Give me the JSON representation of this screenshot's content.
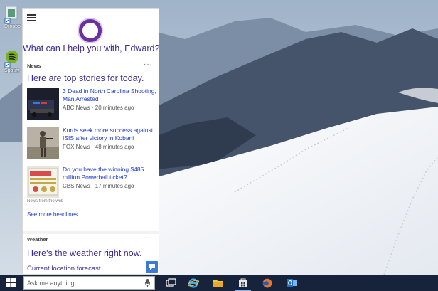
{
  "desktop": {
    "icons": [
      {
        "label": "Dropbox"
      },
      {
        "label": "Spotify"
      }
    ]
  },
  "cortana": {
    "greeting": "What can I help you with, Edward?",
    "news": {
      "title": "News",
      "more": "···",
      "heading": "Here are top stories for today.",
      "stories": [
        {
          "headline": "3 Dead in North Carolina Shooting, Man Arrested",
          "source": "ABC News",
          "time": "20 minutes ago",
          "meta": "ABC News · 20 minutes ago"
        },
        {
          "headline": "Kurds seek more success against ISIS after victory in Kobani",
          "source": "FOX News",
          "time": "48 minutes ago",
          "meta": "FOX News · 48 minutes ago"
        },
        {
          "headline": "Do you have the winning $485 million Powerball ticket?",
          "source": "CBS News",
          "time": "17 minutes ago",
          "meta": "CBS News · 17 minutes ago"
        }
      ],
      "footer_source": "News from the web",
      "see_more": "See more headlines"
    },
    "weather": {
      "title": "Weather",
      "more": "···",
      "heading": "Here's the weather right now.",
      "subheading": "Current location forecast"
    }
  },
  "taskbar": {
    "search_placeholder": "Ask me anything",
    "apps": [
      "task-view",
      "internet-explorer",
      "file-explorer",
      "store",
      "firefox",
      "outlook"
    ]
  },
  "colors": {
    "cortana_accent": "#6b2fa0",
    "heading_color": "#3b2a9a",
    "link_color": "#1f3cd0",
    "taskbar_bg": "#17233a"
  }
}
